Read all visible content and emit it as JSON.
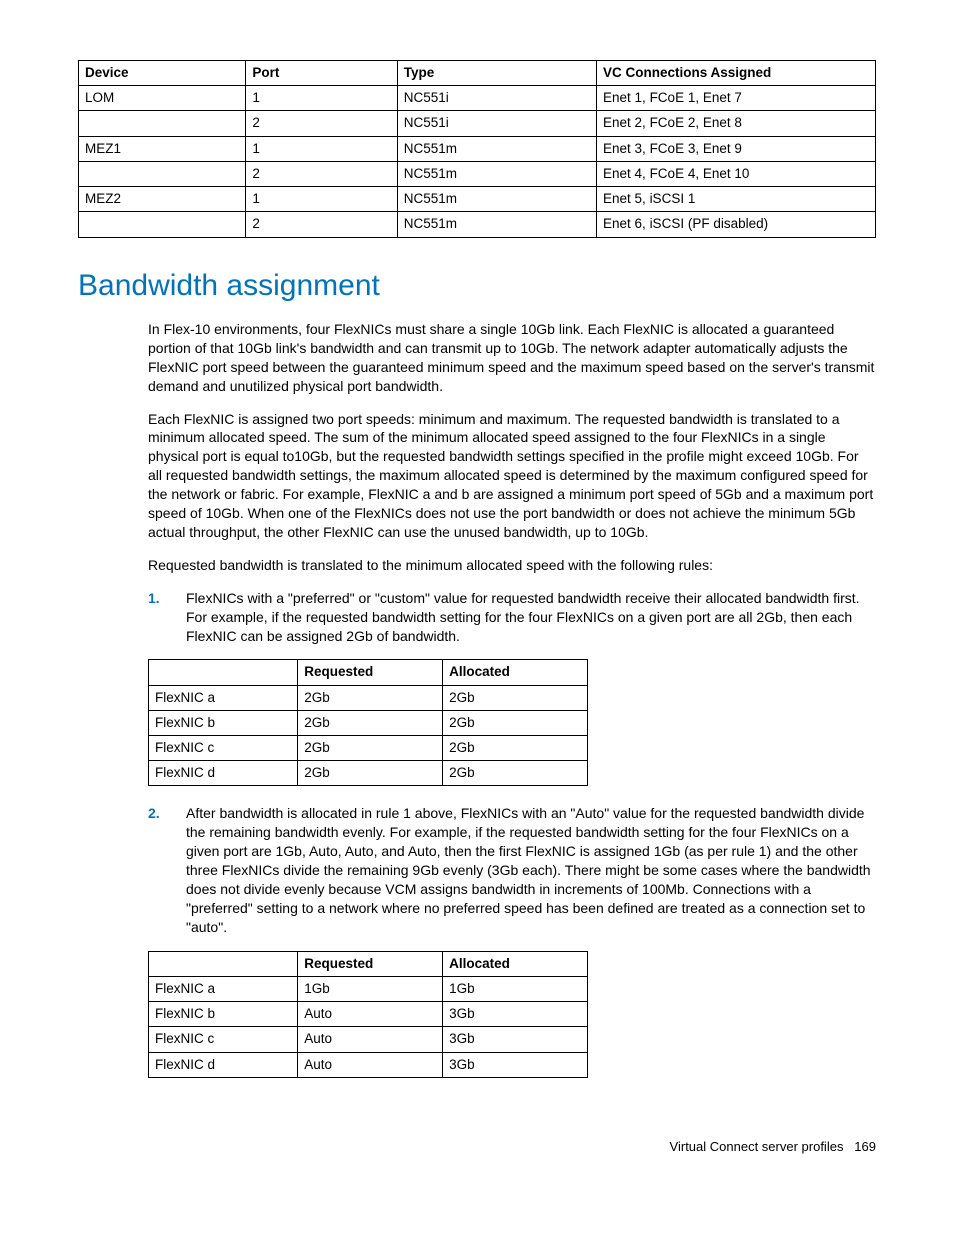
{
  "table1": {
    "headers": [
      "Device",
      "Port",
      "Type",
      "VC Connections Assigned"
    ],
    "rows": [
      [
        "LOM",
        "1",
        "NC551i",
        "Enet 1, FCoE 1, Enet 7"
      ],
      [
        "",
        "2",
        "NC551i",
        "Enet 2, FCoE 2, Enet 8"
      ],
      [
        "MEZ1",
        "1",
        "NC551m",
        "Enet 3, FCoE 3, Enet 9"
      ],
      [
        "",
        "2",
        "NC551m",
        "Enet 4, FCoE 4, Enet 10"
      ],
      [
        "MEZ2",
        "1",
        "NC551m",
        "Enet 5, iSCSI 1"
      ],
      [
        "",
        "2",
        "NC551m",
        "Enet 6, iSCSI (PF disabled)"
      ]
    ]
  },
  "heading": "Bandwidth assignment",
  "para1": "In Flex-10 environments, four FlexNICs must share a single 10Gb link. Each FlexNIC is allocated a guaranteed portion of that 10Gb link's bandwidth and can transmit up to 10Gb. The network adapter automatically adjusts the FlexNIC port speed between the guaranteed minimum speed and the maximum speed based on the server's transmit demand and unutilized physical port bandwidth.",
  "para2": "Each FlexNIC is assigned two port speeds: minimum and maximum. The requested bandwidth is translated to a minimum allocated speed. The sum of the minimum allocated speed assigned to the four FlexNICs in a single physical port is equal to10Gb, but the requested bandwidth settings specified in the profile might exceed 10Gb. For all requested bandwidth settings, the maximum allocated speed is determined by the maximum configured speed for the network or fabric. For example, FlexNIC a and b are assigned a minimum port speed of 5Gb and a maximum port speed of 10Gb. When one of the FlexNICs does not use the port bandwidth or does not achieve the minimum 5Gb actual throughput, the other FlexNIC can use the unused bandwidth, up to 10Gb.",
  "para3": "Requested bandwidth is translated to the minimum allocated speed with the following rules:",
  "rule1": {
    "num": "1.",
    "text": "FlexNICs with a \"preferred\" or \"custom\" value for requested bandwidth receive their allocated bandwidth first. For example, if the requested bandwidth setting for the four FlexNICs on a given port are all 2Gb, then each FlexNIC can be assigned 2Gb of bandwidth."
  },
  "table2": {
    "headers": [
      "",
      "Requested",
      "Allocated"
    ],
    "rows": [
      [
        "FlexNIC a",
        "2Gb",
        "2Gb"
      ],
      [
        "FlexNIC b",
        "2Gb",
        "2Gb"
      ],
      [
        "FlexNIC c",
        "2Gb",
        "2Gb"
      ],
      [
        "FlexNIC d",
        "2Gb",
        "2Gb"
      ]
    ]
  },
  "rule2": {
    "num": "2.",
    "text": "After bandwidth is allocated in rule 1 above, FlexNICs with an \"Auto\" value for the requested bandwidth divide the remaining bandwidth evenly. For example, if the requested bandwidth setting for the four FlexNICs on a given port are 1Gb, Auto, Auto, and Auto, then the first FlexNIC is assigned 1Gb (as per rule 1) and the other three FlexNICs divide the remaining 9Gb evenly (3Gb each). There might be some cases where the bandwidth does not divide evenly because VCM assigns bandwidth in increments of 100Mb. Connections with a \"preferred\" setting to a network where no preferred speed has been defined are treated as a connection set to \"auto\"."
  },
  "table3": {
    "headers": [
      "",
      "Requested",
      "Allocated"
    ],
    "rows": [
      [
        "FlexNIC a",
        "1Gb",
        "1Gb"
      ],
      [
        "FlexNIC b",
        "Auto",
        "3Gb"
      ],
      [
        "FlexNIC c",
        "Auto",
        "3Gb"
      ],
      [
        "FlexNIC d",
        "Auto",
        "3Gb"
      ]
    ]
  },
  "footer": {
    "section": "Virtual Connect server profiles",
    "page": "169"
  }
}
